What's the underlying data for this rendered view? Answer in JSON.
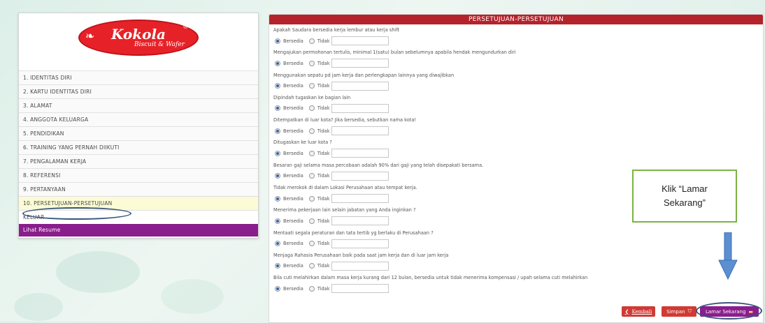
{
  "logo": {
    "brand": "Kokola",
    "tagline": "Biscuit & Wafer",
    "reg": "®"
  },
  "menu": [
    "1. IDENTITAS DIRI",
    "2. KARTU IDENTITAS DIRI",
    "3. ALAMAT",
    "4. ANGGOTA KELUARGA",
    "5. PENDIDIKAN",
    "6. TRAINING YANG PERNAH DIIKUTI",
    "7. PENGALAMAN KERJA",
    "8. REFERENSI",
    "9. PERTANYAAN",
    "10. PERSETUJUAN-PERSETUJUAN",
    "KELUAR",
    "Lihat Resume"
  ],
  "panel_title": "PERSETUJUAN-PERSETUJUAN",
  "options": {
    "yes": "Bersedia",
    "no": "Tidak"
  },
  "questions": [
    "Apakah Saudara bersedia kerja lembur atau kerja shift",
    "Mengajukan permohonan tertulis, minimal 1(satu) bulan sebelumnya apabila hendak mengundurkan diri",
    "Menggunakan sepatu pd jam kerja dan perlengkapan lainnya yang diwajibkan",
    "Dipindah tugaskan ke bagian lain",
    "Ditempatkan di luar kota? Jika bersedia, sebutkan nama kota!",
    "Ditugaskan ke luar kota ?",
    "Besaran gaji selama masa percobaan adalah 90% dari gaji yang telah disepakati bersama.",
    "Tidak merokok di dalam Lokasi Perusahaan atau tempat kerja.",
    "Menerima pekerjaan lain selain jabatan yang Anda inginkan ?",
    "Mentaati segala peraturan dan tata tertib yg berlaku di Perusahaan ?",
    "Menjaga Rahasia Perusahaan baik pada saat jam kerja dan di luar jam kerja",
    "Bila cuti melahirkan dalam masa kerja kurang dari 12 bulan, bersedia untuk tidak menerima kompensasi / upah selama cuti melahirkan"
  ],
  "buttons": {
    "back": "Kembali",
    "save": "Simpan",
    "apply": "Lamar Sekarang"
  },
  "annotation": "Klik “Lamar\nSekarang”",
  "colors": {
    "header": "#b4222a",
    "purple": "#8a1e8c",
    "red_btn": "#d03a34",
    "annot_border": "#7cb342",
    "arrow": "#5b8fd1"
  }
}
